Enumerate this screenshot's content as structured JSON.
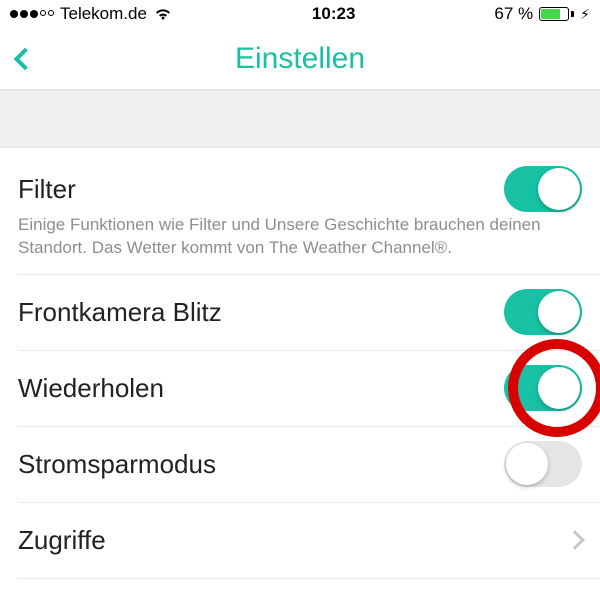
{
  "statusbar": {
    "carrier": "Telekom.de",
    "time": "10:23",
    "battery_pct": "67 %"
  },
  "navbar": {
    "title": "Einstellen"
  },
  "rows": {
    "filter": {
      "label": "Filter",
      "subtext": "Einige Funktionen wie Filter und Unsere Geschichte brauchen deinen Standort. Das Wetter kommt von The Weather Channel®.",
      "on": true
    },
    "front_flash": {
      "label": "Frontkamera Blitz",
      "on": true
    },
    "replay": {
      "label": "Wiederholen",
      "on": true,
      "highlighted": true
    },
    "powersave": {
      "label": "Stromsparmodus",
      "on": false
    },
    "permissions": {
      "label": "Zugriffe"
    }
  },
  "colors": {
    "accent": "#18c1a3",
    "highlight": "#d90000",
    "battery_fill": "#46d84a"
  }
}
